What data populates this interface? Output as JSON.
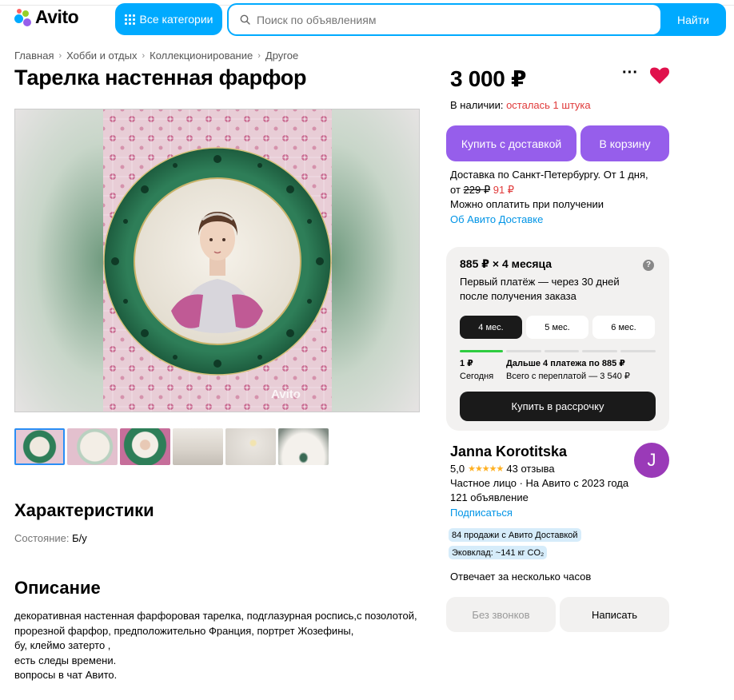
{
  "header": {
    "logo_text": "Avito",
    "categories_label": "Все категории",
    "search_placeholder": "Поиск по объявлениям",
    "search_button": "Найти"
  },
  "breadcrumbs": [
    "Главная",
    "Хобби и отдых",
    "Коллекционирование",
    "Другое"
  ],
  "listing": {
    "title": "Тарелка настенная фарфор",
    "watermark": "Avito",
    "thumbnail_count": 6
  },
  "characteristics": {
    "heading": "Характеристики",
    "items": [
      {
        "label": "Состояние:",
        "value": "Б/у"
      }
    ]
  },
  "description": {
    "heading": "Описание",
    "lines": [
      "декоративная настенная фарфоровая тарелка, подглазурная роспись,с позолотой,",
      "прорезной фарфор, предположительно Франция, портрет Жозефины,",
      "бу, клеймо затерто ,",
      "есть следы времени.",
      "вопросы в чат Авито."
    ]
  },
  "purchase": {
    "price": "3 000 ₽",
    "stock_label": "В наличии:",
    "stock_value": "осталась 1 штука",
    "buy_delivery_button": "Купить с доставкой",
    "cart_button": "В корзину",
    "delivery_line1": "Доставка по Санкт-Петербургу. От 1 дня,",
    "delivery_from": "от",
    "delivery_old_price": "229 ₽",
    "delivery_new_price": "91 ₽",
    "pay_on_receipt": "Можно оплатить при получении",
    "delivery_link": "Об Авито Доставке"
  },
  "installment": {
    "title": "885 ₽ × 4 месяца",
    "subtitle": "Первый платёж — через 30 дней после получения заказа",
    "terms": [
      "4 мес.",
      "5 мес.",
      "6 мес."
    ],
    "selected_term_index": 0,
    "today_amount": "1 ₽",
    "today_label": "Сегодня",
    "next_label": "Дальше 4 платежа по 885 ₽",
    "total_label": "Всего с переплатой — 3 540 ₽",
    "button": "Купить в рассрочку",
    "question_icon": "?"
  },
  "seller": {
    "name": "Janna Korotitska",
    "avatar_letter": "J",
    "avatar_color": "#9a3ab8",
    "rating": "5,0",
    "stars": "★★★★★",
    "reviews": "43 отзыва",
    "type_since": "Частное лицо · На Авито с 2023 года",
    "ads_count": "121 объявление",
    "subscribe": "Подписаться",
    "badge_sales": "84 продажи с Авито Доставкой",
    "badge_eco": "Эковклад: ~141 кг CO₂",
    "response_time": "Отвечает за несколько часов",
    "no_calls_button": "Без звонков",
    "write_button": "Написать"
  },
  "colors": {
    "accent_blue": "#00aaff",
    "purple": "#965eeb",
    "red_text": "#e03a3a",
    "heart": "#e0114c",
    "link": "#0094e6"
  }
}
